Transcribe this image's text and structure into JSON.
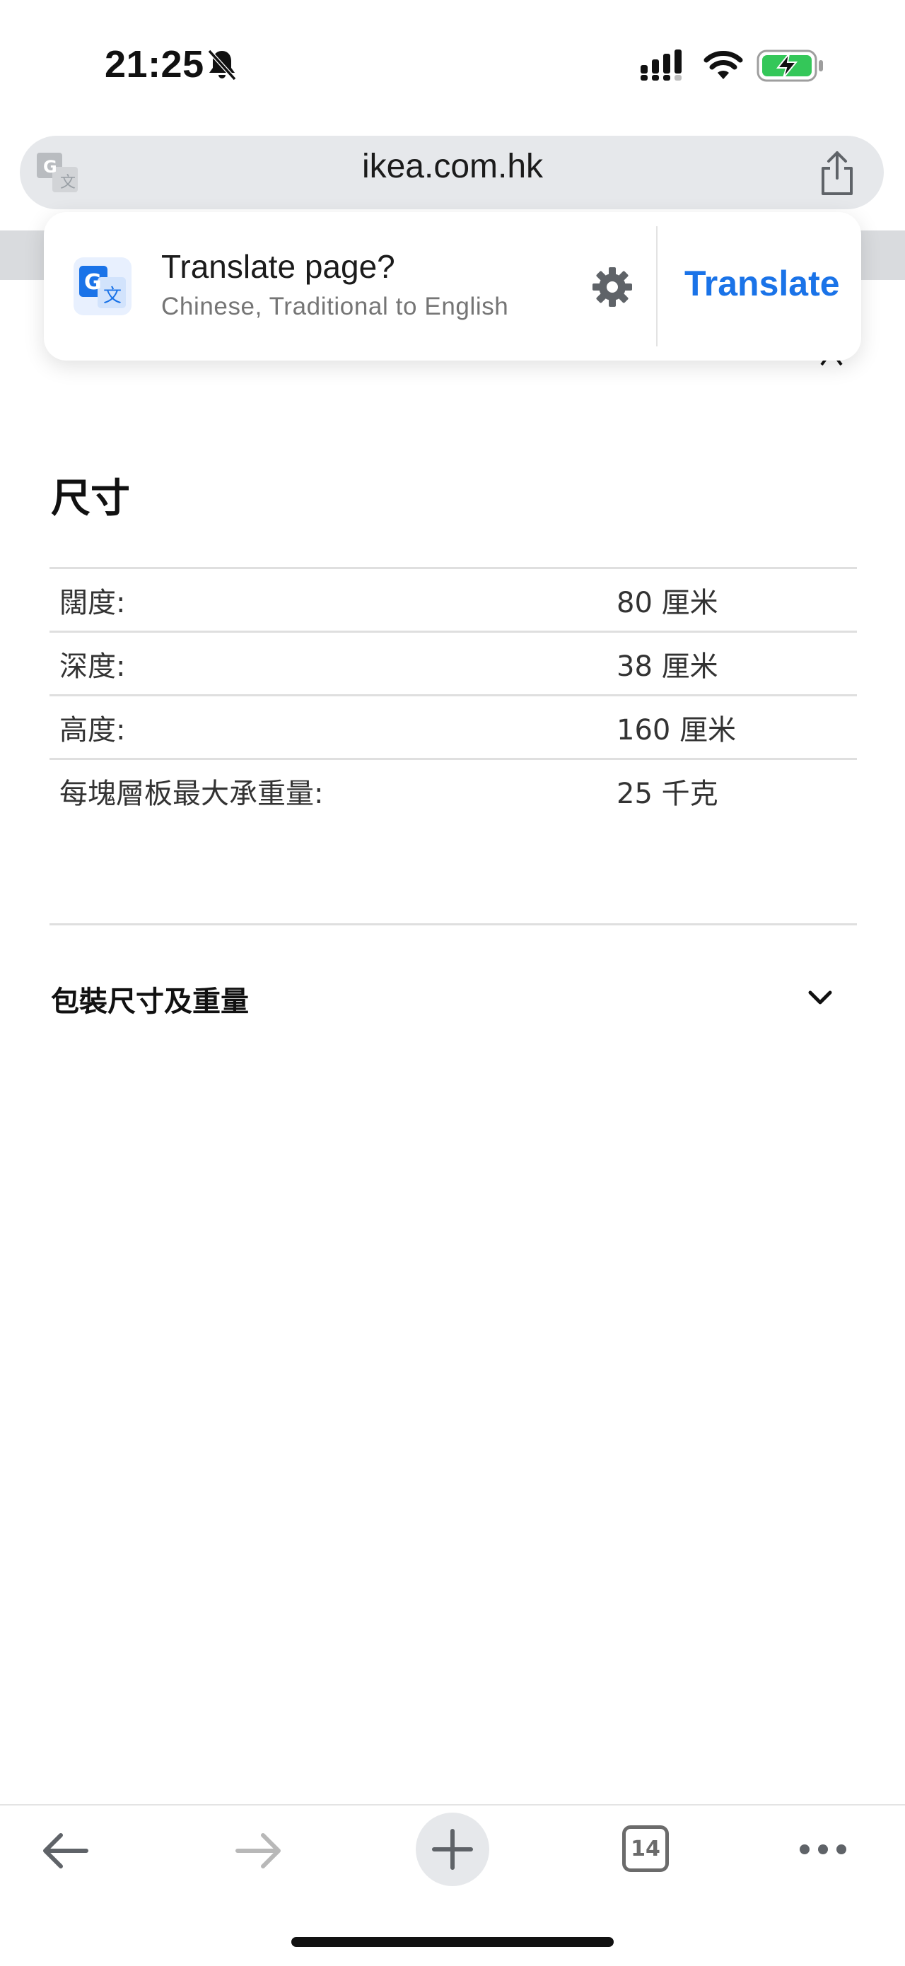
{
  "status_bar": {
    "time": "21:25",
    "icons": [
      "bell-slash-icon",
      "cellular-signal-icon",
      "wifi-icon",
      "battery-charging-icon"
    ],
    "battery_color": "#34c759"
  },
  "address_bar": {
    "url": "ikea.com.hk",
    "left_icon": "translate-icon",
    "right_icon": "share-icon"
  },
  "translate_prompt": {
    "title": "Translate page?",
    "subtitle": "Chinese, Traditional to English",
    "settings_icon": "gear-icon",
    "action_label": "Translate",
    "accent": "#1a73e8"
  },
  "dimensions": {
    "title": "尺寸",
    "rows": [
      {
        "label": "闊度:",
        "value": "80 厘米"
      },
      {
        "label": "深度:",
        "value": "38 厘米"
      },
      {
        "label": "高度:",
        "value": "160 厘米"
      },
      {
        "label": "每塊層板最大承重量:",
        "value": "25 千克"
      }
    ]
  },
  "package_section": {
    "title": "包裝尺寸及重量",
    "icon": "chevron-down-icon"
  },
  "toolbar": {
    "items": [
      "back-arrow-icon",
      "forward-arrow-icon",
      "plus-icon",
      "tabs-icon",
      "more-icon"
    ],
    "tab_count": "14"
  }
}
